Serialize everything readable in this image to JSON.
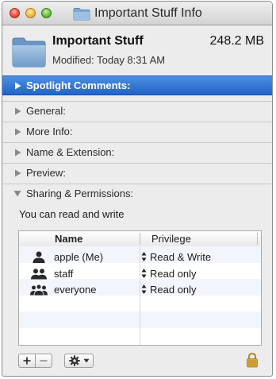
{
  "window": {
    "title": "Important Stuff Info"
  },
  "header": {
    "name": "Important Stuff",
    "size": "248.2 MB",
    "modified": "Modified: Today 8:31 AM"
  },
  "sections": {
    "spotlight": "Spotlight Comments:",
    "general": "General:",
    "more_info": "More Info:",
    "name_extension": "Name & Extension:",
    "preview": "Preview:",
    "sharing": "Sharing & Permissions:"
  },
  "permissions": {
    "summary": "You can read and write",
    "columns": {
      "name": "Name",
      "privilege": "Privilege"
    },
    "rows": [
      {
        "name": "apple (Me)",
        "privilege": "Read & Write",
        "icon": "single-user-icon"
      },
      {
        "name": "staff",
        "privilege": "Read only",
        "icon": "group-icon"
      },
      {
        "name": "everyone",
        "privilege": "Read only",
        "icon": "everyone-icon"
      }
    ]
  },
  "colors": {
    "selection_blue": "#2f74d3",
    "folder_blue": "#8fb3d6",
    "lock_gold": "#d8a33a"
  }
}
